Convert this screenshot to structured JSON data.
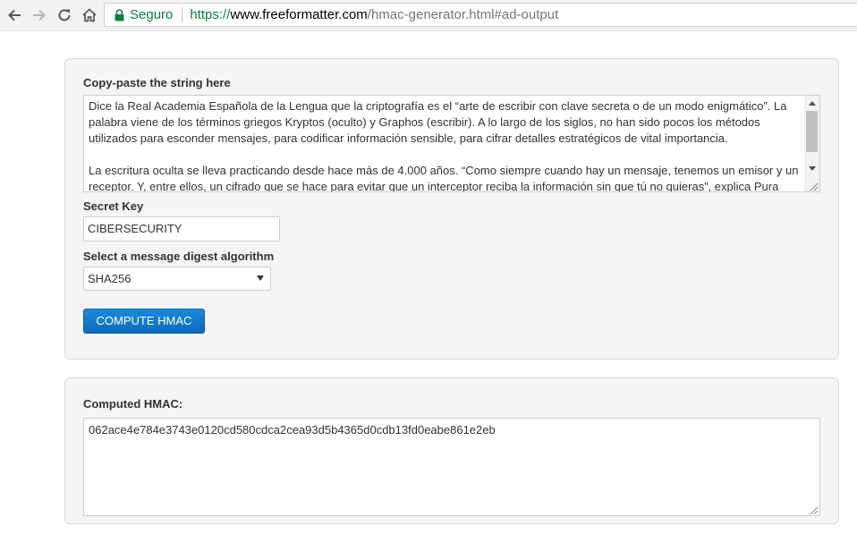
{
  "browser": {
    "secure_label": "Seguro",
    "url_scheme": "https://",
    "url_host": "www.freeformatter.com",
    "url_path": "/hmac-generator.html#ad-output"
  },
  "input_section": {
    "label": "Copy-paste the string here",
    "paragraph_1": "Dice la Real Academia Española de la Lengua que la criptografía es el “arte de escribir con clave secreta o de un modo enigmático”. La palabra viene de los términos griegos Kryptos (oculto) y Graphos (escribir). A lo largo de los siglos, no han sido pocos los métodos utilizados para esconder mensajes, para codificar información sensible, para cifrar detalles estratégicos de vital importancia.",
    "paragraph_2": "La escritura oculta se lleva practicando desde hace más de 4.000 años. “Como siempre cuando hay un mensaje, tenemos un emisor y un receptor. Y, entre ellos, un cifrado que se hace para evitar que un interceptor reciba la información sin que tú no quieras”, explica Pura"
  },
  "secret_key": {
    "label": "Secret Key",
    "value": "CIBERSECURITY"
  },
  "algorithm": {
    "label": "Select a message digest algorithm",
    "selected": "SHA256"
  },
  "compute_button": {
    "label": "COMPUTE HMAC"
  },
  "output_section": {
    "label": "Computed HMAC:",
    "value": "062ace4e784e3743e0120cd580cdca2cea93d5b4365d0cdb13fd0eabe861e2eb"
  },
  "colors": {
    "secure_green": "#0b8043",
    "button_blue": "#1a8ad8"
  },
  "icons": [
    "back-arrow-icon",
    "forward-arrow-icon",
    "reload-icon",
    "home-icon",
    "lock-icon",
    "dropdown-arrow-icon",
    "resize-grip-icon"
  ]
}
